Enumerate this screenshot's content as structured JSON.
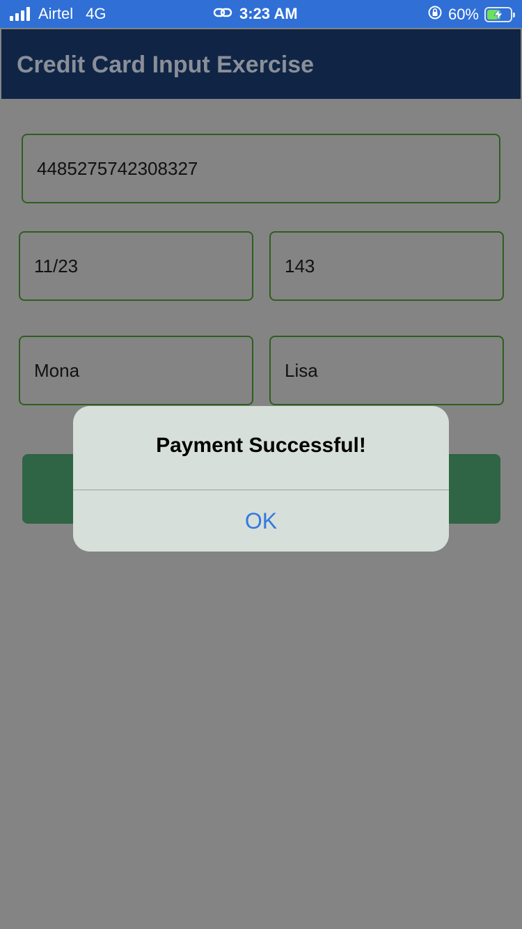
{
  "status_bar": {
    "carrier": "Airtel",
    "network": "4G",
    "time": "3:23 AM",
    "battery": "60%",
    "battery_level": 0.6,
    "icons": [
      "signal-icon",
      "link-icon",
      "orientation-lock-icon",
      "battery-charging-icon"
    ]
  },
  "header": {
    "title": "Credit Card Input Exercise"
  },
  "form": {
    "card_number": "4485275742308327",
    "expiry": "11/23",
    "cvc": "143",
    "first_name": "Mona",
    "last_name": "Lisa"
  },
  "alert": {
    "title": "Payment Successful!",
    "ok_label": "OK"
  },
  "colors": {
    "status_bar": "#2f6fd6",
    "header_bg": "#102546",
    "field_border": "#2e5e1e",
    "pay_button": "#2f6444",
    "alert_bg": "#d6dfd9",
    "alert_button_text": "#3478e0"
  }
}
